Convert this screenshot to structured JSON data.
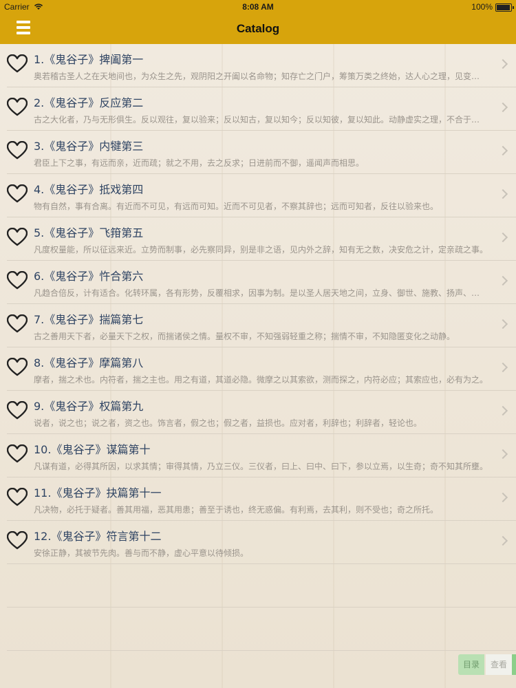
{
  "status_bar": {
    "carrier": "Carrier",
    "time": "8:08 AM",
    "battery": "100%"
  },
  "nav": {
    "title": "Catalog",
    "menu_icon": "hamburger-menu-icon",
    "accent_color": "#d7a40c"
  },
  "items": [
    {
      "title": "1.《鬼谷子》捭阖第一",
      "excerpt": "奥若稽古圣人之在天地间也，为众生之先，观阴阳之开阖以名命物；知存亡之门户，筹策万类之终始，达人心之理，见变化之朕焉，而守司其门户。"
    },
    {
      "title": "2.《鬼谷子》反应第二",
      "excerpt": "古之大化者，乃与无形俱生。反以观往，复以验来；反以知古，复以知今；反以知彼，复以知此。动静虚实之理，不合于今，反古而求之。"
    },
    {
      "title": "3.《鬼谷子》内犍第三",
      "excerpt": "君臣上下之事，有远而亲，近而疏；就之不用，去之反求；日进前而不御，遥闻声而相思。"
    },
    {
      "title": "4.《鬼谷子》抵戏第四",
      "excerpt": "物有自然，事有合离。有近而不可见，有远而可知。近而不可见者，不察其辞也；远而可知者，反往以验来也。"
    },
    {
      "title": "5.《鬼谷子》飞箝第五",
      "excerpt": "凡度权量能，所以征远来近。立势而制事，必先察同异，别是非之语，见内外之辞，知有无之数，决安危之计，定亲疏之事。"
    },
    {
      "title": "6.《鬼谷子》忤合第六",
      "excerpt": "凡趋合倍反，计有适合。化转环属，各有形势，反覆相求，因事为制。是以圣人居天地之间，立身、御世、施教、扬声、明名也。"
    },
    {
      "title": "7.《鬼谷子》揣篇第七",
      "excerpt": "古之善用天下者，必量天下之权，而揣诸侯之情。量权不审，不知强弱轻重之称；揣情不审，不知隐匿变化之动静。"
    },
    {
      "title": "8.《鬼谷子》摩篇第八",
      "excerpt": "摩者，揣之术也。内符者，揣之主也。用之有道，其道必隐。微摩之以其索欲，测而探之，内符必应；其索应也，必有为之。"
    },
    {
      "title": "9.《鬼谷子》权篇第九",
      "excerpt": "说者，说之也；说之者，资之也。饰言者，假之也；假之者，益损也。应对者，利辞也；利辞者，轻论也。"
    },
    {
      "title": "10.《鬼谷子》谋篇第十",
      "excerpt": "凡谋有道，必得其所因，以求其情；审得其情，乃立三仪。三仪者，曰上、曰中、曰下，参以立焉，以生奇；奇不知其所壅。"
    },
    {
      "title": "11.《鬼谷子》抉篇第十一",
      "excerpt": "凡决物，必托于疑者。善其用福，恶其用患；善至于诱也，终无惑偏。有利焉，去其利，则不受也；奇之所托。"
    },
    {
      "title": "12.《鬼谷子》符言第十二",
      "excerpt": "安徐正静，其被节先肉。善与而不静，虚心平意以待倾损。"
    }
  ],
  "bottom_tabs": {
    "catalog": "目录",
    "view": "查看"
  }
}
